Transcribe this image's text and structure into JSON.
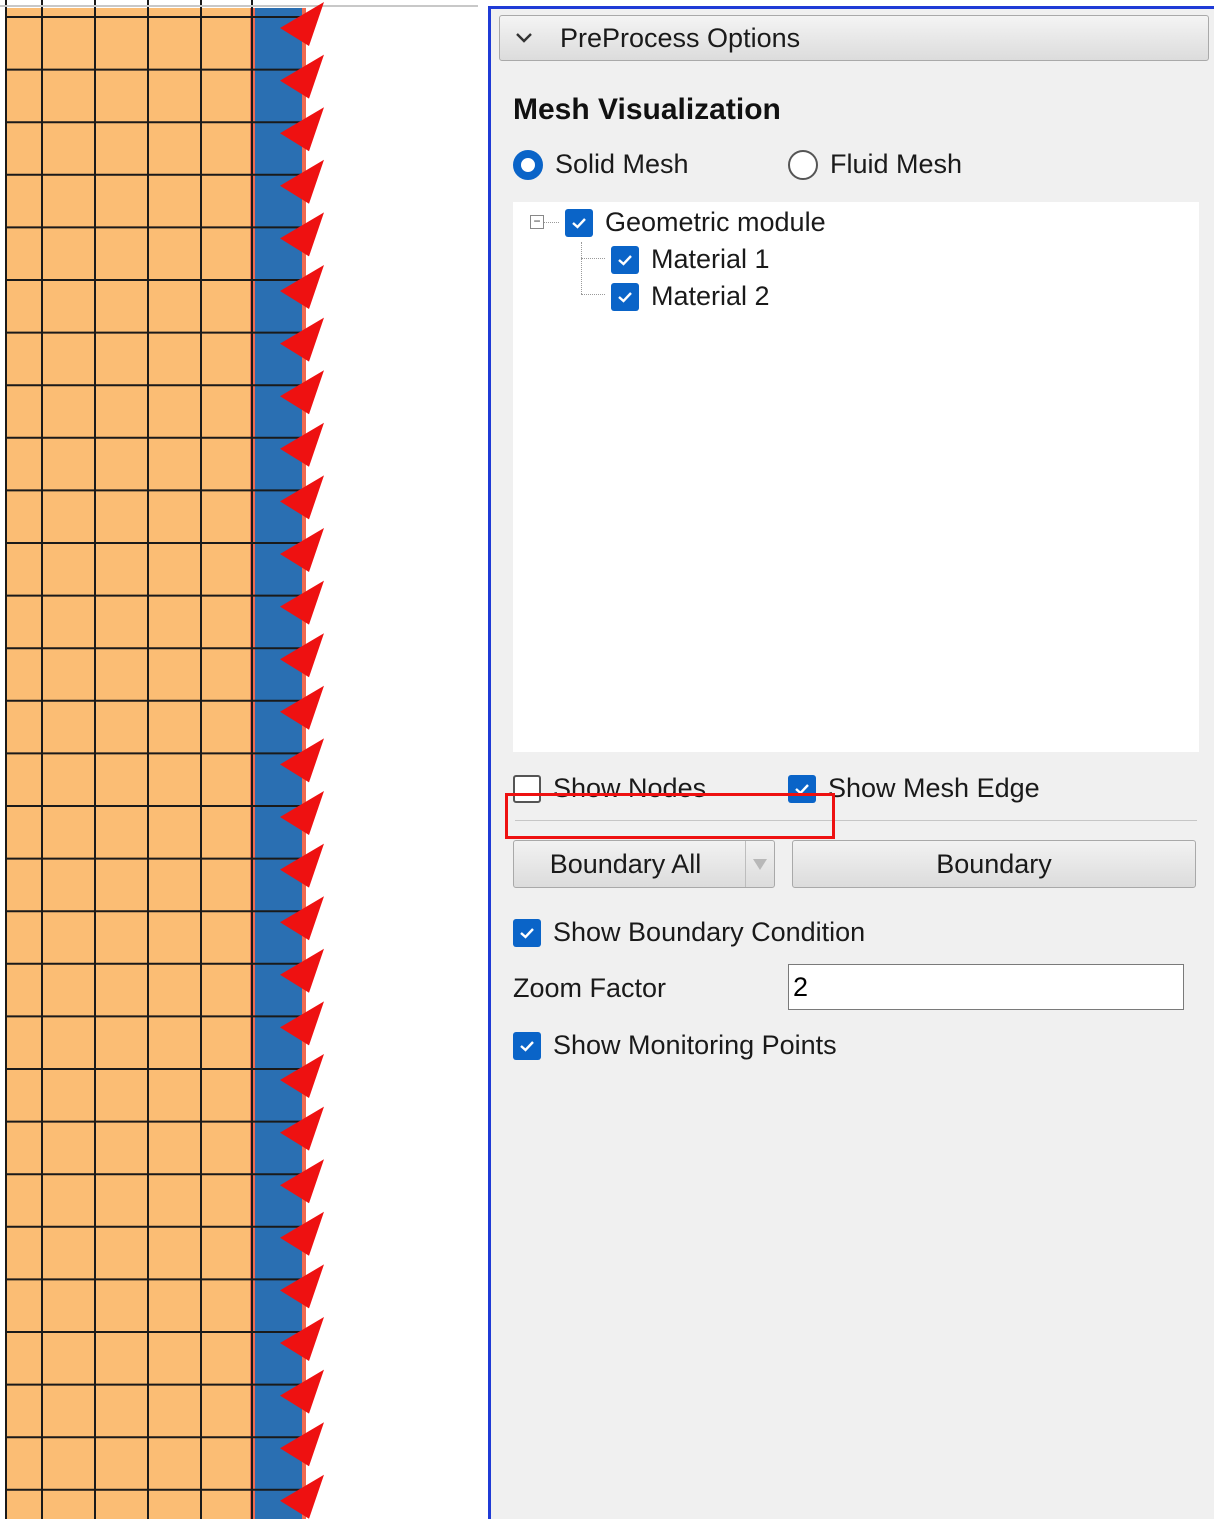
{
  "colors": {
    "mesh_fill": "#fbbd74",
    "mesh_line": "#1a1a1a",
    "boundary_band": "#2a6fb2",
    "boundary_edge": "#f06a50",
    "arrow": "#ee1111",
    "accent": "#0a64c8",
    "panel_border": "#1f3bd6",
    "highlight_box": "#ee1111"
  },
  "panel": {
    "header": {
      "title": "PreProcess Options",
      "icon": "chevron-down-icon"
    },
    "section_title": "Mesh Visualization",
    "mesh_type": {
      "options": [
        {
          "label": "Solid Mesh",
          "selected": true
        },
        {
          "label": "Fluid Mesh",
          "selected": false
        }
      ]
    },
    "tree": {
      "root": {
        "label": "Geometric module",
        "checked": true,
        "expanded": true
      },
      "children": [
        {
          "label": "Material 1",
          "checked": true
        },
        {
          "label": "Material 2",
          "checked": true
        }
      ]
    },
    "show_nodes": {
      "label": "Show Nodes",
      "checked": false
    },
    "show_mesh_edge": {
      "label": "Show Mesh Edge",
      "checked": true
    },
    "boundary_combo": {
      "value": "Boundary All"
    },
    "boundary_button": {
      "label": "Boundary"
    },
    "show_boundary_condition": {
      "label": "Show Boundary Condition",
      "checked": true
    },
    "zoom": {
      "label": "Zoom Factor",
      "value": "2"
    },
    "show_monitoring_points": {
      "label": "Show Monitoring Points",
      "checked": true
    }
  }
}
